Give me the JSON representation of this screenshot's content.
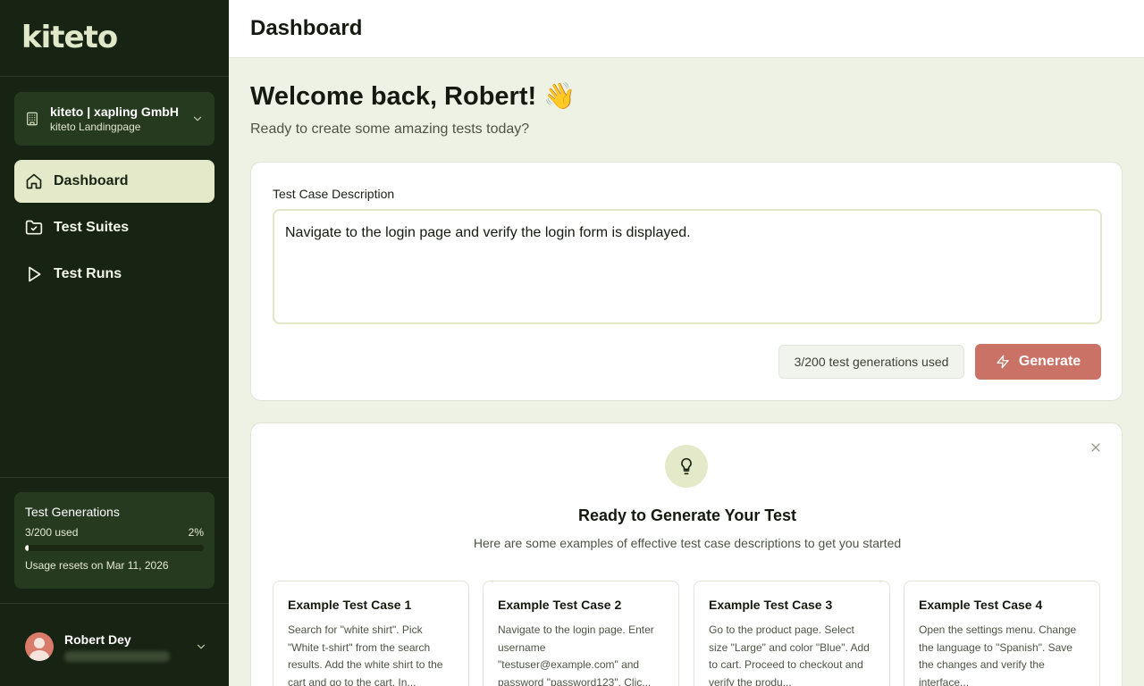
{
  "app": {
    "logo": "kiteto"
  },
  "sidebar": {
    "org": {
      "name": "kiteto | xapling GmbH",
      "project": "kiteto Landingpage"
    },
    "nav": [
      {
        "label": "Dashboard"
      },
      {
        "label": "Test Suites"
      },
      {
        "label": "Test Runs"
      }
    ],
    "usage": {
      "title": "Test Generations",
      "used_label": "3/200 used",
      "percent_label": "2%",
      "percent": 2,
      "reset": "Usage resets on Mar 11, 2026"
    },
    "user": {
      "name": "Robert Dey"
    }
  },
  "header": {
    "title": "Dashboard"
  },
  "main": {
    "welcome": "Welcome back, Robert! 👋",
    "subtitle": "Ready to create some amazing tests today?",
    "form": {
      "label": "Test Case Description",
      "value": "Navigate to the login page and verify the login form is displayed.",
      "usage_badge": "3/200 test generations used",
      "generate": "Generate"
    },
    "examples_panel": {
      "title": "Ready to Generate Your Test",
      "subtitle": "Here are some examples of effective test case descriptions to get you started",
      "items": [
        {
          "title": "Example Test Case 1",
          "desc": "Search for \"white shirt\". Pick \"White t-shirt\" from the search results. Add the white shirt to the cart and go to the cart. In..."
        },
        {
          "title": "Example Test Case 2",
          "desc": "Navigate to the login page. Enter username \"testuser@example.com\" and password \"password123\". Clic..."
        },
        {
          "title": "Example Test Case 3",
          "desc": "Go to the product page. Select size \"Large\" and color \"Blue\". Add to cart. Proceed to checkout and verify the produ..."
        },
        {
          "title": "Example Test Case 4",
          "desc": "Open the settings menu. Change the language to \"Spanish\". Save the changes and verify the interface..."
        }
      ]
    }
  },
  "colors": {
    "sidebar_bg": "#172313",
    "accent": "#cb7266",
    "active_nav": "#e3e9c9",
    "page_bg": "#eef2e4"
  }
}
